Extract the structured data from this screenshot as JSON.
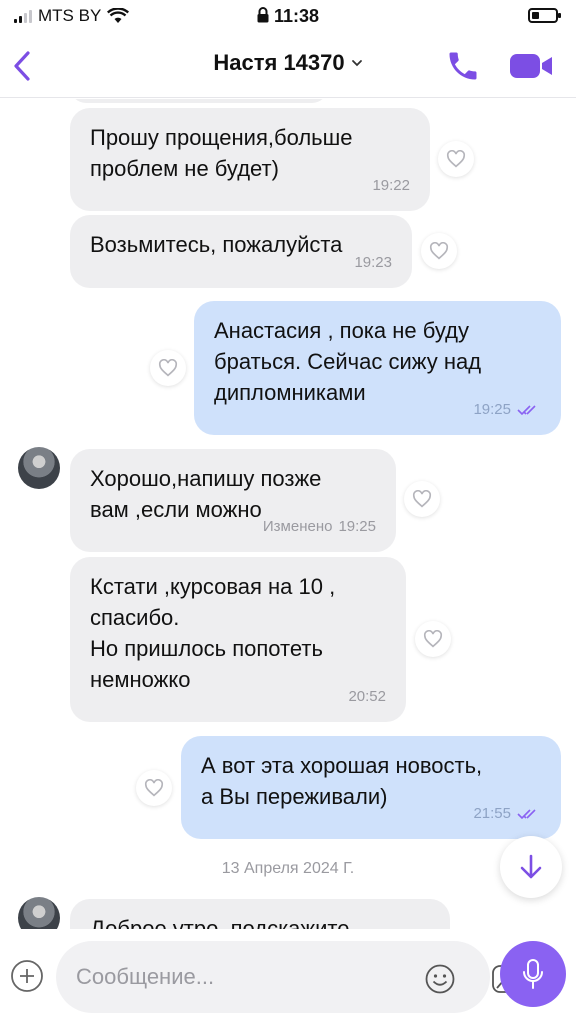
{
  "status_bar": {
    "carrier": "MTS BY",
    "time": "11:38",
    "battery_level": 0.3
  },
  "header": {
    "contact_name": "Настя 14370",
    "dropdown_icon": "chevron-down-icon",
    "back_icon": "chevron-left-icon",
    "call_icon": "phone-icon",
    "video_icon": "video-camera-icon"
  },
  "messages": [
    {
      "direction": "in",
      "text": "Прошу прощения,больше\nпроблем не будет)",
      "time": "19:22"
    },
    {
      "direction": "in",
      "text": "Возьмитесь, пожалуйста",
      "time": "19:23"
    },
    {
      "direction": "out",
      "text": "Анастасия , пока не буду\nбраться. Сейчас сижу над\nдипломниками",
      "time": "19:25",
      "status": "read"
    },
    {
      "direction": "in",
      "text": "Хорошо,напишу позже\nвам ,если можно",
      "time": "19:25",
      "edited_label": "Изменено"
    },
    {
      "direction": "in",
      "text": "Кстати ,курсовая на 10 ,\nспасибо.\nНо пришлось попотеть\nнемножко",
      "time": "20:52"
    },
    {
      "direction": "out",
      "text": "А вот эта хорошая новость,\nа Вы переживали)",
      "time": "21:55",
      "status": "read"
    }
  ],
  "date_separator": "13 Апреля 2024 Г.",
  "partial_message": "Доброе утро, подскажите",
  "input": {
    "placeholder": "Сообщение..."
  },
  "colors": {
    "accent": "#8a62f2",
    "incoming_bubble": "#eeeef0",
    "outgoing_bubble": "#cfe1fb"
  }
}
